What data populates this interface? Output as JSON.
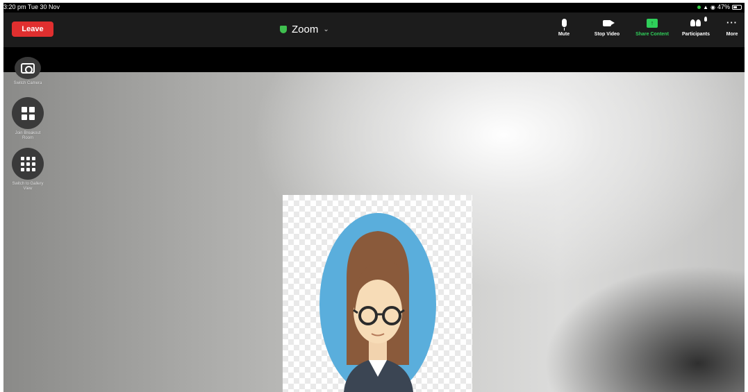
{
  "status_bar": {
    "time": "3:20 pm  Tue 30 Nov",
    "battery": "47%"
  },
  "toolbar": {
    "leave_label": "Leave",
    "meeting_title": "Zoom",
    "title_chevron_icon": "chevron-down-icon",
    "items": [
      {
        "label": "Mute",
        "icon": "microphone-icon"
      },
      {
        "label": "Stop Video",
        "icon": "video-camera-icon"
      },
      {
        "label": "Share Content",
        "icon": "share-screen-icon",
        "color": "#2fcf5a"
      },
      {
        "label": "Participants",
        "icon": "participants-icon",
        "count": "2"
      },
      {
        "label": "More",
        "icon": "more-dots-icon"
      }
    ]
  },
  "side_controls": [
    {
      "label": "Switch Camera",
      "icon": "switch-camera-icon"
    },
    {
      "label": "Join Breakout Room",
      "icon": "breakout-room-icon"
    },
    {
      "label": "Switch to Gallery View",
      "icon": "gallery-view-icon"
    }
  ],
  "colors": {
    "leave_button": "#e02f2f",
    "toolbar_bg": "#1c1c1c",
    "share_active": "#2fcf5a",
    "avatar_circle": "#5aaedc"
  }
}
